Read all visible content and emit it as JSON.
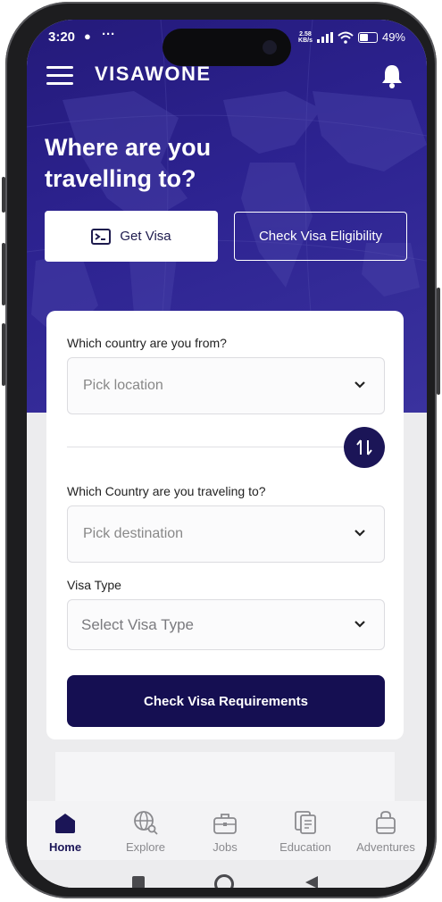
{
  "status_bar": {
    "time": "3:20",
    "net_speed_value": "2.58",
    "net_speed_unit": "KB/s",
    "battery": "49%"
  },
  "appbar": {
    "logo": "VISAWONE"
  },
  "hero": {
    "title": "Where are you travelling to?",
    "tab_get_visa": "Get Visa",
    "tab_check_eligibility": "Check Visa Eligibility"
  },
  "form": {
    "from_label": "Which country are you from?",
    "from_placeholder": "Pick location",
    "to_label": "Which Country are you traveling to?",
    "to_placeholder": "Pick destination",
    "visa_type_label": "Visa Type",
    "visa_type_placeholder": "Select Visa Type",
    "submit_label": "Check Visa Requirements"
  },
  "bottom_nav": {
    "items": [
      {
        "label": "Home",
        "icon": "home-icon",
        "active": true
      },
      {
        "label": "Explore",
        "icon": "globe-search-icon",
        "active": false
      },
      {
        "label": "Jobs",
        "icon": "briefcase-icon",
        "active": false
      },
      {
        "label": "Education",
        "icon": "document-icon",
        "active": false
      },
      {
        "label": "Adventures",
        "icon": "bag-icon",
        "active": false
      }
    ]
  },
  "colors": {
    "primary": "#1b1557",
    "hero_bg": "#2d2391",
    "card_bg": "#ffffff"
  }
}
